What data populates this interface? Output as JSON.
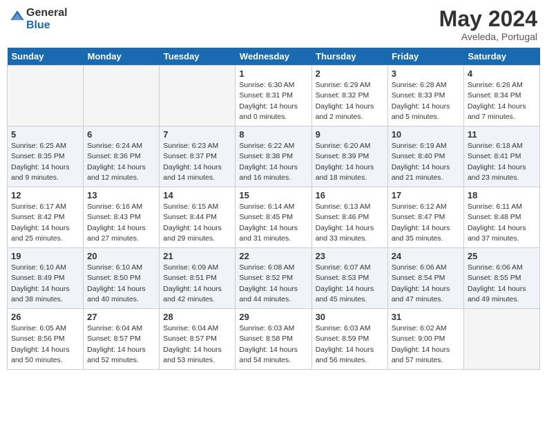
{
  "header": {
    "logo_line1": "General",
    "logo_line2": "Blue",
    "month_title": "May 2024",
    "location": "Aveleda, Portugal"
  },
  "weekdays": [
    "Sunday",
    "Monday",
    "Tuesday",
    "Wednesday",
    "Thursday",
    "Friday",
    "Saturday"
  ],
  "weeks": [
    [
      {
        "day": "",
        "empty": true
      },
      {
        "day": "",
        "empty": true
      },
      {
        "day": "",
        "empty": true
      },
      {
        "day": "1",
        "sunrise": "Sunrise: 6:30 AM",
        "sunset": "Sunset: 8:31 PM",
        "daylight": "Daylight: 14 hours and 0 minutes."
      },
      {
        "day": "2",
        "sunrise": "Sunrise: 6:29 AM",
        "sunset": "Sunset: 8:32 PM",
        "daylight": "Daylight: 14 hours and 2 minutes."
      },
      {
        "day": "3",
        "sunrise": "Sunrise: 6:28 AM",
        "sunset": "Sunset: 8:33 PM",
        "daylight": "Daylight: 14 hours and 5 minutes."
      },
      {
        "day": "4",
        "sunrise": "Sunrise: 6:26 AM",
        "sunset": "Sunset: 8:34 PM",
        "daylight": "Daylight: 14 hours and 7 minutes."
      }
    ],
    [
      {
        "day": "5",
        "sunrise": "Sunrise: 6:25 AM",
        "sunset": "Sunset: 8:35 PM",
        "daylight": "Daylight: 14 hours and 9 minutes."
      },
      {
        "day": "6",
        "sunrise": "Sunrise: 6:24 AM",
        "sunset": "Sunset: 8:36 PM",
        "daylight": "Daylight: 14 hours and 12 minutes."
      },
      {
        "day": "7",
        "sunrise": "Sunrise: 6:23 AM",
        "sunset": "Sunset: 8:37 PM",
        "daylight": "Daylight: 14 hours and 14 minutes."
      },
      {
        "day": "8",
        "sunrise": "Sunrise: 6:22 AM",
        "sunset": "Sunset: 8:38 PM",
        "daylight": "Daylight: 14 hours and 16 minutes."
      },
      {
        "day": "9",
        "sunrise": "Sunrise: 6:20 AM",
        "sunset": "Sunset: 8:39 PM",
        "daylight": "Daylight: 14 hours and 18 minutes."
      },
      {
        "day": "10",
        "sunrise": "Sunrise: 6:19 AM",
        "sunset": "Sunset: 8:40 PM",
        "daylight": "Daylight: 14 hours and 21 minutes."
      },
      {
        "day": "11",
        "sunrise": "Sunrise: 6:18 AM",
        "sunset": "Sunset: 8:41 PM",
        "daylight": "Daylight: 14 hours and 23 minutes."
      }
    ],
    [
      {
        "day": "12",
        "sunrise": "Sunrise: 6:17 AM",
        "sunset": "Sunset: 8:42 PM",
        "daylight": "Daylight: 14 hours and 25 minutes."
      },
      {
        "day": "13",
        "sunrise": "Sunrise: 6:16 AM",
        "sunset": "Sunset: 8:43 PM",
        "daylight": "Daylight: 14 hours and 27 minutes."
      },
      {
        "day": "14",
        "sunrise": "Sunrise: 6:15 AM",
        "sunset": "Sunset: 8:44 PM",
        "daylight": "Daylight: 14 hours and 29 minutes."
      },
      {
        "day": "15",
        "sunrise": "Sunrise: 6:14 AM",
        "sunset": "Sunset: 8:45 PM",
        "daylight": "Daylight: 14 hours and 31 minutes."
      },
      {
        "day": "16",
        "sunrise": "Sunrise: 6:13 AM",
        "sunset": "Sunset: 8:46 PM",
        "daylight": "Daylight: 14 hours and 33 minutes."
      },
      {
        "day": "17",
        "sunrise": "Sunrise: 6:12 AM",
        "sunset": "Sunset: 8:47 PM",
        "daylight": "Daylight: 14 hours and 35 minutes."
      },
      {
        "day": "18",
        "sunrise": "Sunrise: 6:11 AM",
        "sunset": "Sunset: 8:48 PM",
        "daylight": "Daylight: 14 hours and 37 minutes."
      }
    ],
    [
      {
        "day": "19",
        "sunrise": "Sunrise: 6:10 AM",
        "sunset": "Sunset: 8:49 PM",
        "daylight": "Daylight: 14 hours and 38 minutes."
      },
      {
        "day": "20",
        "sunrise": "Sunrise: 6:10 AM",
        "sunset": "Sunset: 8:50 PM",
        "daylight": "Daylight: 14 hours and 40 minutes."
      },
      {
        "day": "21",
        "sunrise": "Sunrise: 6:09 AM",
        "sunset": "Sunset: 8:51 PM",
        "daylight": "Daylight: 14 hours and 42 minutes."
      },
      {
        "day": "22",
        "sunrise": "Sunrise: 6:08 AM",
        "sunset": "Sunset: 8:52 PM",
        "daylight": "Daylight: 14 hours and 44 minutes."
      },
      {
        "day": "23",
        "sunrise": "Sunrise: 6:07 AM",
        "sunset": "Sunset: 8:53 PM",
        "daylight": "Daylight: 14 hours and 45 minutes."
      },
      {
        "day": "24",
        "sunrise": "Sunrise: 6:06 AM",
        "sunset": "Sunset: 8:54 PM",
        "daylight": "Daylight: 14 hours and 47 minutes."
      },
      {
        "day": "25",
        "sunrise": "Sunrise: 6:06 AM",
        "sunset": "Sunset: 8:55 PM",
        "daylight": "Daylight: 14 hours and 49 minutes."
      }
    ],
    [
      {
        "day": "26",
        "sunrise": "Sunrise: 6:05 AM",
        "sunset": "Sunset: 8:56 PM",
        "daylight": "Daylight: 14 hours and 50 minutes."
      },
      {
        "day": "27",
        "sunrise": "Sunrise: 6:04 AM",
        "sunset": "Sunset: 8:57 PM",
        "daylight": "Daylight: 14 hours and 52 minutes."
      },
      {
        "day": "28",
        "sunrise": "Sunrise: 6:04 AM",
        "sunset": "Sunset: 8:57 PM",
        "daylight": "Daylight: 14 hours and 53 minutes."
      },
      {
        "day": "29",
        "sunrise": "Sunrise: 6:03 AM",
        "sunset": "Sunset: 8:58 PM",
        "daylight": "Daylight: 14 hours and 54 minutes."
      },
      {
        "day": "30",
        "sunrise": "Sunrise: 6:03 AM",
        "sunset": "Sunset: 8:59 PM",
        "daylight": "Daylight: 14 hours and 56 minutes."
      },
      {
        "day": "31",
        "sunrise": "Sunrise: 6:02 AM",
        "sunset": "Sunset: 9:00 PM",
        "daylight": "Daylight: 14 hours and 57 minutes."
      },
      {
        "day": "",
        "empty": true
      }
    ]
  ]
}
